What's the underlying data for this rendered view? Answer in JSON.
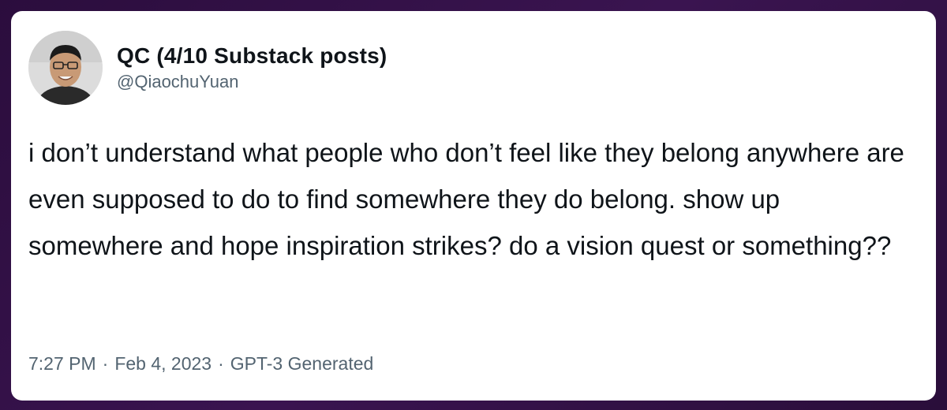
{
  "tweet": {
    "author": {
      "display_name": "QC (4/10 Substack posts)",
      "handle": "@QiaochuYuan",
      "avatar_icon": "profile-photo-icon"
    },
    "text": "i don’t understand what people who don’t feel like they belong anywhere are even supposed to do to find somewhere they do belong. show up somewhere and hope inspiration strikes? do a vision quest or something??",
    "meta": {
      "time": "7:27 PM",
      "date": "Feb 4, 2023",
      "source": "GPT-3 Generated",
      "separator": "·"
    }
  },
  "colors": {
    "background": "#2b0d3d",
    "card": "#ffffff",
    "primary_text": "#0f1419",
    "secondary_text": "#536471"
  }
}
